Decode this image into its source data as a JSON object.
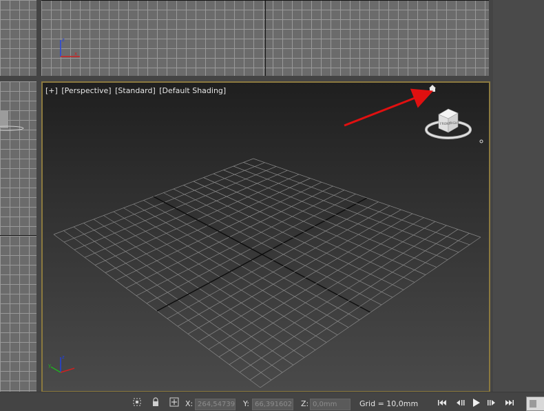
{
  "viewport": {
    "label_plus": "[+]",
    "label_view": "[Perspective]",
    "label_mode": "[Standard]",
    "label_shading": "[Default Shading]"
  },
  "viewcube": {
    "front_face": "FRONT",
    "right_face": "RIGHT"
  },
  "statusbar": {
    "x_label": "X:",
    "x_value": "264,54739",
    "y_label": "Y:",
    "y_value": "66,391602",
    "z_label": "Z:",
    "z_value": "0,0mm",
    "grid_text": "Grid = 10,0mm"
  },
  "icons": {
    "selection_lock": "lock-icon",
    "isolate": "isolate-icon",
    "absolute_mode": "transform-mode-icon",
    "goto_start": "goto-start-icon",
    "prev_frame": "prev-frame-icon",
    "play": "play-icon",
    "next_frame": "next-frame-icon",
    "goto_end": "goto-end-icon"
  },
  "colors": {
    "active_viewport_border": "#8c7a3f",
    "annotation_arrow": "#e01010",
    "axis_x": "#d02020",
    "axis_y": "#20b020",
    "axis_z": "#2040e0"
  }
}
